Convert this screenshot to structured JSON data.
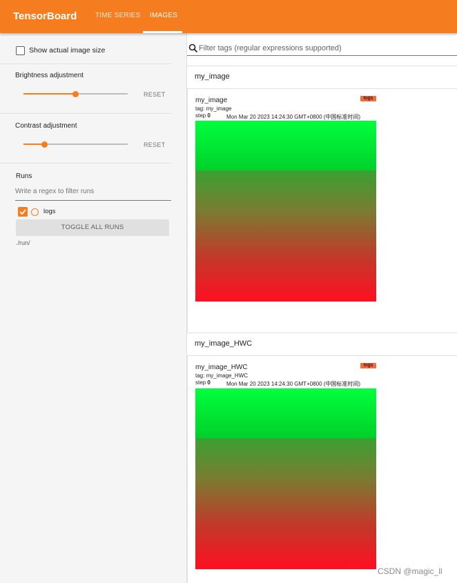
{
  "app": {
    "title": "TensorBoard",
    "tabs": [
      {
        "label": "TIME SERIES",
        "active": false
      },
      {
        "label": "IMAGES",
        "active": true
      }
    ],
    "accent_color": "#f57c1f"
  },
  "sidebar": {
    "show_actual_size": {
      "label": "Show actual image size",
      "checked": false
    },
    "brightness": {
      "label": "Brightness adjustment",
      "value_fraction": 0.5,
      "reset_label": "RESET"
    },
    "contrast": {
      "label": "Contrast adjustment",
      "value_fraction": 0.2,
      "reset_label": "RESET"
    },
    "runs": {
      "title": "Runs",
      "filter_placeholder": "Write a regex to filter runs",
      "items": [
        {
          "label": "logs",
          "checked": true,
          "color": "#f57c1f"
        }
      ],
      "toggle_all_label": "TOGGLE ALL RUNS",
      "path": "./run/"
    }
  },
  "main": {
    "filter_placeholder": "Filter tags (regular expressions supported)",
    "groups": [
      {
        "title": "my_image",
        "card": {
          "title": "my_image",
          "tag": "tag: my_image",
          "step_label": "step",
          "step_value": "0",
          "timestamp": "Mon Mar 20 2023 14:24:30 GMT+0800 (中国标准时间)",
          "run_badge": "logs"
        }
      },
      {
        "title": "my_image_HWC",
        "card": {
          "title": "my_image_HWC",
          "tag": "tag: my_image_HWC",
          "step_label": "step",
          "step_value": "0",
          "timestamp": "Mon Mar 20 2023 14:24:30 GMT+0800 (中国标准时间)",
          "run_badge": "logs"
        }
      }
    ]
  },
  "watermark": "CSDN @magic_ll"
}
